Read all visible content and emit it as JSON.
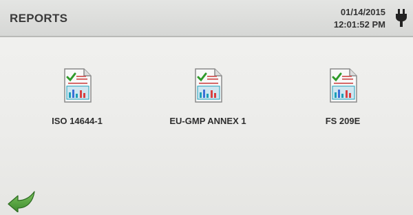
{
  "header": {
    "title": "REPORTS",
    "date": "01/14/2015",
    "time": "12:01:52 PM"
  },
  "reports": [
    {
      "label": "ISO 14644-1",
      "icon": "report-document-icon"
    },
    {
      "label": "EU-GMP ANNEX 1",
      "icon": "report-document-icon"
    },
    {
      "label": "FS 209E",
      "icon": "report-document-icon"
    }
  ],
  "footer": {
    "back_icon": "back-arrow-icon"
  },
  "colors": {
    "check": "#2f9a2a",
    "chart_blue": "#3b6fd8",
    "chart_red": "#d94040",
    "doc_teal": "#1d9fb8",
    "back_arrow": "#4a9a3a"
  }
}
